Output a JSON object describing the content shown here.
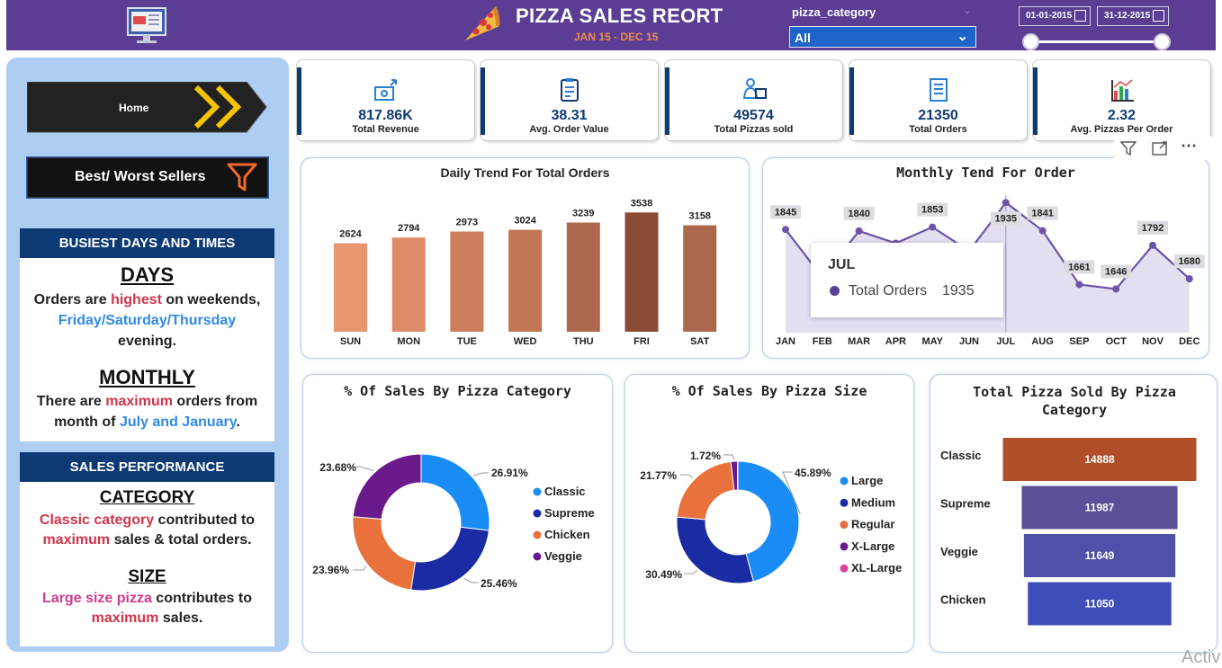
{
  "header": {
    "title": "PIZZA SALES REORT",
    "subtitle": "JAN 15 - DEC 15",
    "filter_label": "pizza_category",
    "filter_value": "All",
    "date_start": "01-01-2015",
    "date_end": "31-12-2015",
    "icons": {
      "logo": "monitor-icon",
      "pizza": "pizza-icon",
      "calendar": "calendar-icon"
    },
    "colors": {
      "bg": "#5b3e94",
      "subtitle": "#f08a4b",
      "select": "#1f65c9"
    }
  },
  "nav": {
    "home_label": "Home",
    "best_worst_label": "Best/ Worst Sellers"
  },
  "insights": {
    "busiest": {
      "heading": "BUSIEST DAYS AND TIMES",
      "days_title": "DAYS",
      "days_p1": "Orders are ",
      "days_hl1": "highest",
      "days_p2": " on weekends,",
      "days_hl2": "Friday/Saturday/Thursday",
      "days_p3": "evening.",
      "monthly_title": "MONTHLY",
      "monthly_p1": "There are ",
      "monthly_hl1": "maximum",
      "monthly_p2": " orders from",
      "monthly_p3": "month of ",
      "monthly_hl2": "July and January",
      "monthly_p4": "."
    },
    "performance": {
      "heading": "SALES PERFORMANCE",
      "cat_title": "CATEGORY",
      "cat_hl1": "Classic category",
      "cat_p1": " contributed to",
      "cat_hl2": "maximum",
      "cat_p2": " sales & total orders.",
      "size_title": "SIZE",
      "size_hl1": "Large size pizza",
      "size_p1": " contributes to",
      "size_hl2": "maximum",
      "size_p2": " sales."
    }
  },
  "kpis": [
    {
      "value": "817.86K",
      "label": "Total Revenue",
      "icon": "revenue-icon"
    },
    {
      "value": "38.31",
      "label": "Avg. Order Value",
      "icon": "clipboard-icon"
    },
    {
      "value": "49574",
      "label": "Total Pizzas sold",
      "icon": "delivery-icon"
    },
    {
      "value": "21350",
      "label": "Total Orders",
      "icon": "order-list-icon"
    },
    {
      "value": "2.32",
      "label": "Avg. Pizzas Per Order",
      "icon": "bar-chart-icon"
    }
  ],
  "tooltip": {
    "month": "JUL",
    "label": "Total Orders",
    "value": "1935"
  },
  "watermark": "Activ",
  "chart_data": [
    {
      "type": "bar",
      "title": "Daily Trend For Total Orders",
      "categories": [
        "SUN",
        "MON",
        "TUE",
        "WED",
        "THU",
        "FRI",
        "SAT"
      ],
      "values": [
        2624,
        2794,
        2973,
        3024,
        3239,
        3538,
        3158
      ],
      "colors": [
        "#e9956f",
        "#dd8a67",
        "#cd7d5c",
        "#c27655",
        "#ac684c",
        "#894b35",
        "#ac684c"
      ]
    },
    {
      "type": "area",
      "title": "Monthly Tend For Order",
      "categories": [
        "JAN",
        "FEB",
        "MAR",
        "APR",
        "MAY",
        "JUN",
        "JUL",
        "AUG",
        "SEP",
        "OCT",
        "NOV",
        "DEC"
      ],
      "values": [
        1845,
        1685,
        1840,
        1799,
        1853,
        1773,
        1935,
        1841,
        1661,
        1646,
        1792,
        1680
      ],
      "labels": [
        "1845",
        "",
        "1840",
        "",
        "1853",
        "",
        "1935",
        "1841",
        "1661",
        "1646",
        "1792",
        "1680"
      ],
      "color": "#6c54a6"
    },
    {
      "type": "pie",
      "title": "% Of Sales By Pizza Category",
      "categories": [
        "Classic",
        "Supreme",
        "Chicken",
        "Veggie"
      ],
      "values": [
        26.91,
        25.46,
        23.96,
        23.68
      ],
      "labels": [
        "26.91%",
        "25.46%",
        "23.96%",
        "23.68%"
      ],
      "colors": [
        "#1a8cf5",
        "#1a2ba3",
        "#e8713c",
        "#6a1a8a"
      ]
    },
    {
      "type": "pie",
      "title": "% Of Sales By Pizza Size",
      "categories": [
        "Large",
        "Medium",
        "Regular",
        "X-Large",
        "XL-Large"
      ],
      "values": [
        45.89,
        30.49,
        21.77,
        1.72,
        0.12
      ],
      "labels": [
        "45.89%",
        "30.49%",
        "21.77%",
        "1.72%",
        ""
      ],
      "colors": [
        "#1a8cf5",
        "#1a2ba3",
        "#e8713c",
        "#6a1a8a",
        "#e040a0"
      ]
    },
    {
      "type": "bar",
      "orientation": "horizontal",
      "title": "Total Pizza Sold By Pizza Category",
      "categories": [
        "Classic",
        "Supreme",
        "Veggie",
        "Chicken"
      ],
      "values": [
        14888,
        11987,
        11649,
        11050
      ],
      "colors": [
        "#b04f27",
        "#5d4f97",
        "#5050a8",
        "#3f4db8"
      ]
    }
  ]
}
